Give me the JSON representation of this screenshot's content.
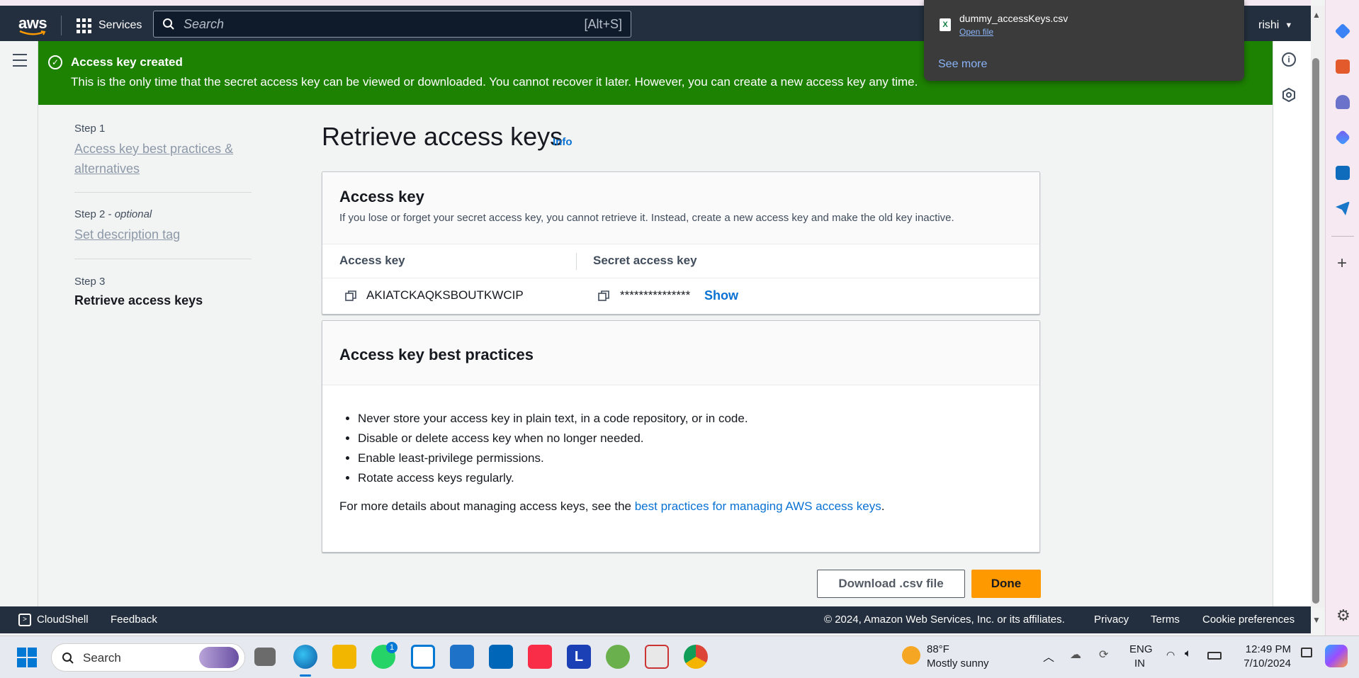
{
  "nav": {
    "logo": "aws",
    "services_label": "Services",
    "search_placeholder": "Search",
    "search_shortcut": "[Alt+S]",
    "user": "rishi"
  },
  "download_popup": {
    "filename": "dummy_accessKeys.csv",
    "open_label": "Open file",
    "see_more": "See more"
  },
  "flash": {
    "title": "Access key created",
    "message": "This is the only time that the secret access key can be viewed or downloaded. You cannot recover it later. However, you can create a new access key any time."
  },
  "steps": [
    {
      "label": "Step 1",
      "title": "Access key best practices & alternatives"
    },
    {
      "label": "Step 2",
      "optional": "optional",
      "title": "Set description tag"
    },
    {
      "label": "Step 3",
      "title": "Retrieve access keys"
    }
  ],
  "page": {
    "title": "Retrieve access keys",
    "info": "Info"
  },
  "access_key_card": {
    "heading": "Access key",
    "description": "If you lose or forget your secret access key, you cannot retrieve it. Instead, create a new access key and make the old key inactive.",
    "col_access_key": "Access key",
    "col_secret_key": "Secret access key",
    "access_key_value": "AKIATCKAQKSBOUTKWCIP",
    "secret_masked": "***************",
    "show_label": "Show"
  },
  "best_practices": {
    "heading": "Access key best practices",
    "items": [
      "Never store your access key in plain text, in a code repository, or in code.",
      "Disable or delete access key when no longer needed.",
      "Enable least-privilege permissions.",
      "Rotate access keys regularly."
    ],
    "more_prefix": "For more details about managing access keys, see the ",
    "more_link": "best practices for managing AWS access keys",
    "more_suffix": "."
  },
  "buttons": {
    "download": "Download .csv file",
    "done": "Done"
  },
  "footer": {
    "cloudshell": "CloudShell",
    "feedback": "Feedback",
    "copyright": "© 2024, Amazon Web Services, Inc. or its affiliates.",
    "privacy": "Privacy",
    "terms": "Terms",
    "cookies": "Cookie preferences"
  },
  "taskbar": {
    "search": "Search",
    "whatsapp_badge": "1",
    "weather_temp": "88°F",
    "weather_desc": "Mostly sunny",
    "lang_1": "ENG",
    "lang_2": "IN",
    "time": "12:49 PM",
    "date": "7/10/2024"
  },
  "colors": {
    "aws_nav": "#232f3e",
    "success": "#1d8102",
    "link": "#0972d3",
    "primary_button": "#ff9900"
  }
}
